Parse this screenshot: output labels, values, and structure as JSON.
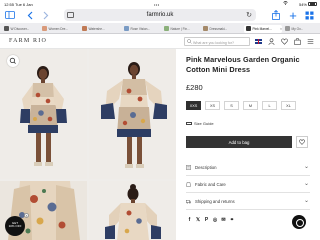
{
  "status": {
    "time": "12:55  Tue 6 Jan",
    "dots": "•••",
    "battery": "54%"
  },
  "browser": {
    "domain": "farmrio.uk",
    "tabs": [
      {
        "label": "W Discover...",
        "color": "#555555"
      },
      {
        "label": "Women Dre...",
        "color": "#d99a7a"
      },
      {
        "label": "Watershe...",
        "color": "#c07a55"
      },
      {
        "label": "Rose Vision...",
        "color": "#7a9bc4"
      },
      {
        "label": "Nature | Fin...",
        "color": "#8bb07a"
      },
      {
        "label": "Dressmaki...",
        "color": "#a58a6a"
      },
      {
        "label": "Pink Marvel...",
        "color": "#333333",
        "active": true
      },
      {
        "label": "My Ov...",
        "color": "#999999"
      }
    ]
  },
  "site": {
    "logo": "FARM RIO",
    "search_placeholder": "What are you looking for?"
  },
  "product": {
    "title": "Pink Marvelous Garden Organic Cotton Mini Dress",
    "price": "£280",
    "sizes": [
      {
        "label": "XXS",
        "selected": true
      },
      {
        "label": "XS"
      },
      {
        "label": "S"
      },
      {
        "label": "M"
      },
      {
        "label": "L"
      },
      {
        "label": "XL"
      }
    ],
    "size_guide": "Size Guide",
    "add_to_bag": "Add to bag",
    "accordions": [
      "Description",
      "Fabric and Care",
      "Shipping and returns"
    ]
  },
  "promo": {
    "line1": "GET",
    "line2": "10% OFF"
  },
  "colors": {
    "accent": "#1a73e8",
    "dark": "#2f2f2f"
  }
}
